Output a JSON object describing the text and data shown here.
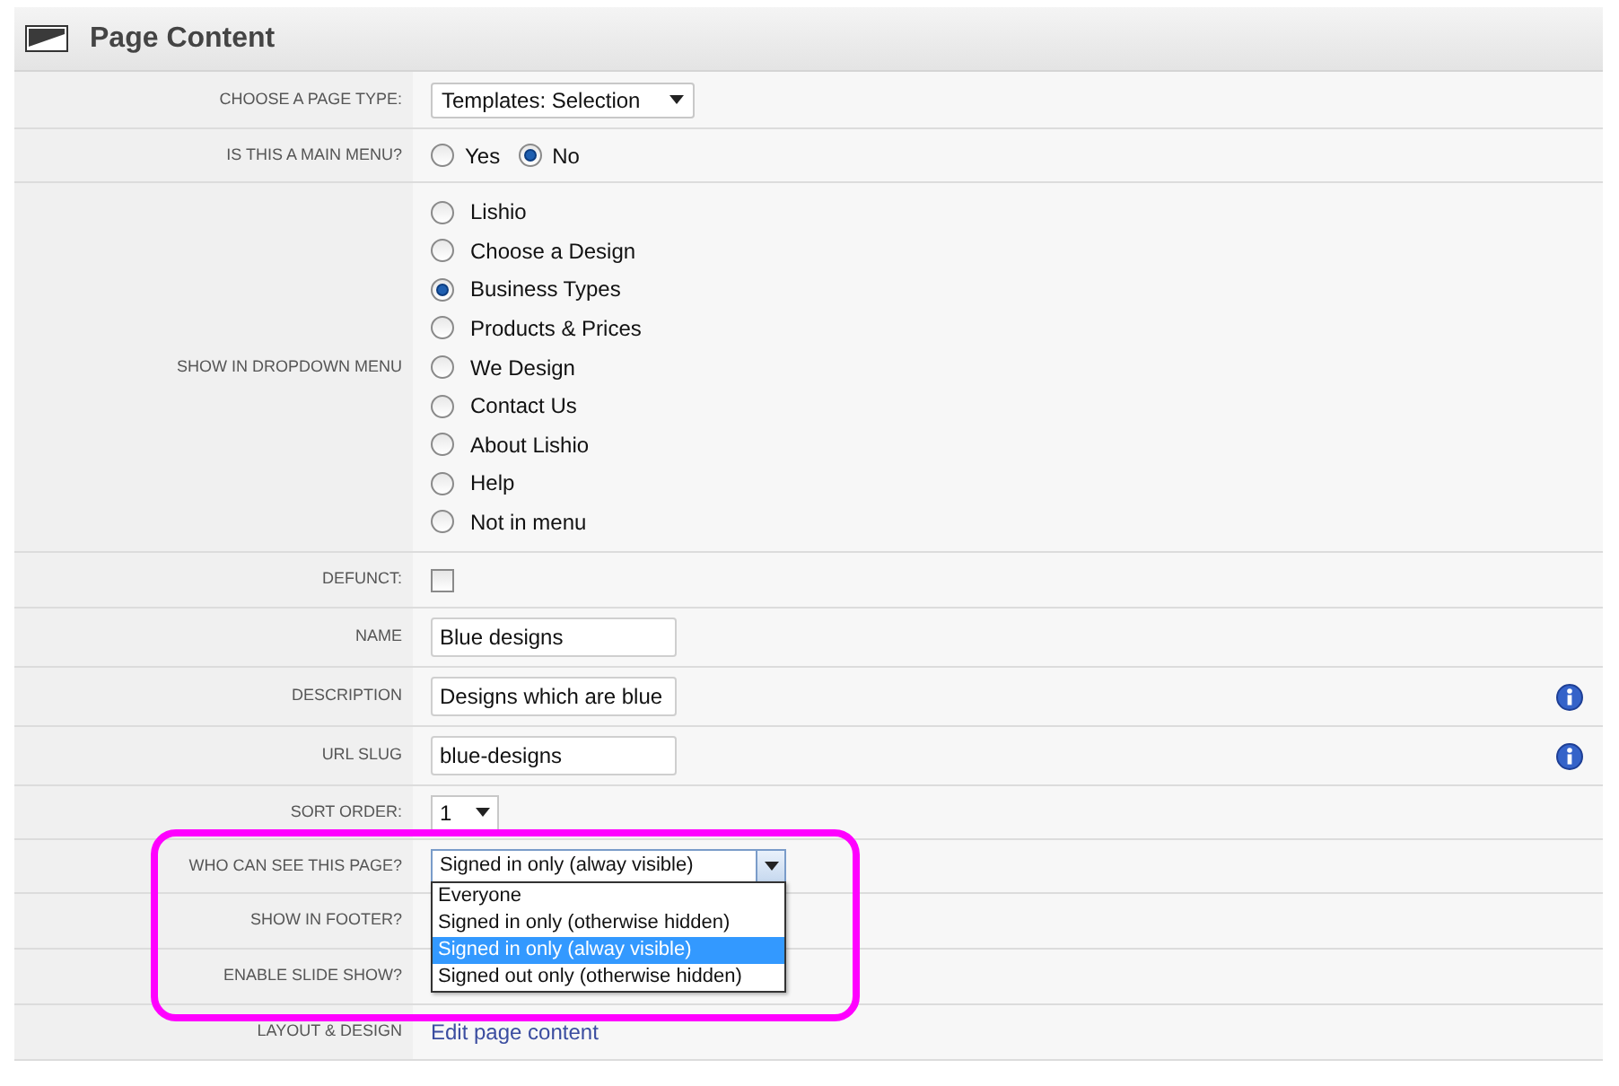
{
  "header": {
    "title": "Page Content"
  },
  "rows": [
    {
      "label": "CHOOSE A PAGE TYPE:",
      "kind": "select",
      "value": "Templates: Selection"
    },
    {
      "label": "IS THIS A MAIN MENU?",
      "kind": "radio_inline",
      "options": [
        {
          "label": "Yes",
          "selected": false
        },
        {
          "label": "No",
          "selected": true
        }
      ]
    },
    {
      "label": "SHOW IN DROPDOWN MENU",
      "kind": "radio_list",
      "options": [
        {
          "label": "Lishio",
          "selected": false
        },
        {
          "label": "Choose a Design",
          "selected": false
        },
        {
          "label": "Business Types",
          "selected": true
        },
        {
          "label": "Products & Prices",
          "selected": false
        },
        {
          "label": "We Design",
          "selected": false
        },
        {
          "label": "Contact Us",
          "selected": false
        },
        {
          "label": "About Lishio",
          "selected": false
        },
        {
          "label": "Help",
          "selected": false
        },
        {
          "label": "Not in menu",
          "selected": false
        }
      ]
    },
    {
      "label": "DEFUNCT:",
      "kind": "checkbox",
      "checked": false
    },
    {
      "label": "NAME",
      "kind": "text",
      "value": "Blue designs",
      "info": false
    },
    {
      "label": "DESCRIPTION",
      "kind": "text",
      "value": "Designs which are blue",
      "info": true
    },
    {
      "label": "URL SLUG",
      "kind": "text",
      "value": "blue-designs",
      "info": true
    },
    {
      "label": "SORT ORDER:",
      "kind": "select_small",
      "value": "1"
    },
    {
      "label": "WHO CAN SEE THIS PAGE?",
      "kind": "select_open",
      "value": "Signed in only (alway visible)",
      "highlighted": true,
      "options": [
        {
          "label": "Everyone",
          "selected": false
        },
        {
          "label": "Signed in only (otherwise hidden)",
          "selected": false
        },
        {
          "label": "Signed in only (alway visible)",
          "selected": true
        },
        {
          "label": "Signed out only (otherwise hidden)",
          "selected": false
        }
      ]
    },
    {
      "label": "SHOW IN FOOTER?",
      "kind": "covered"
    },
    {
      "label": "ENABLE SLIDE SHOW?",
      "kind": "covered"
    },
    {
      "label": "LAYOUT & DESIGN",
      "kind": "link",
      "value": "Edit page content"
    }
  ]
}
